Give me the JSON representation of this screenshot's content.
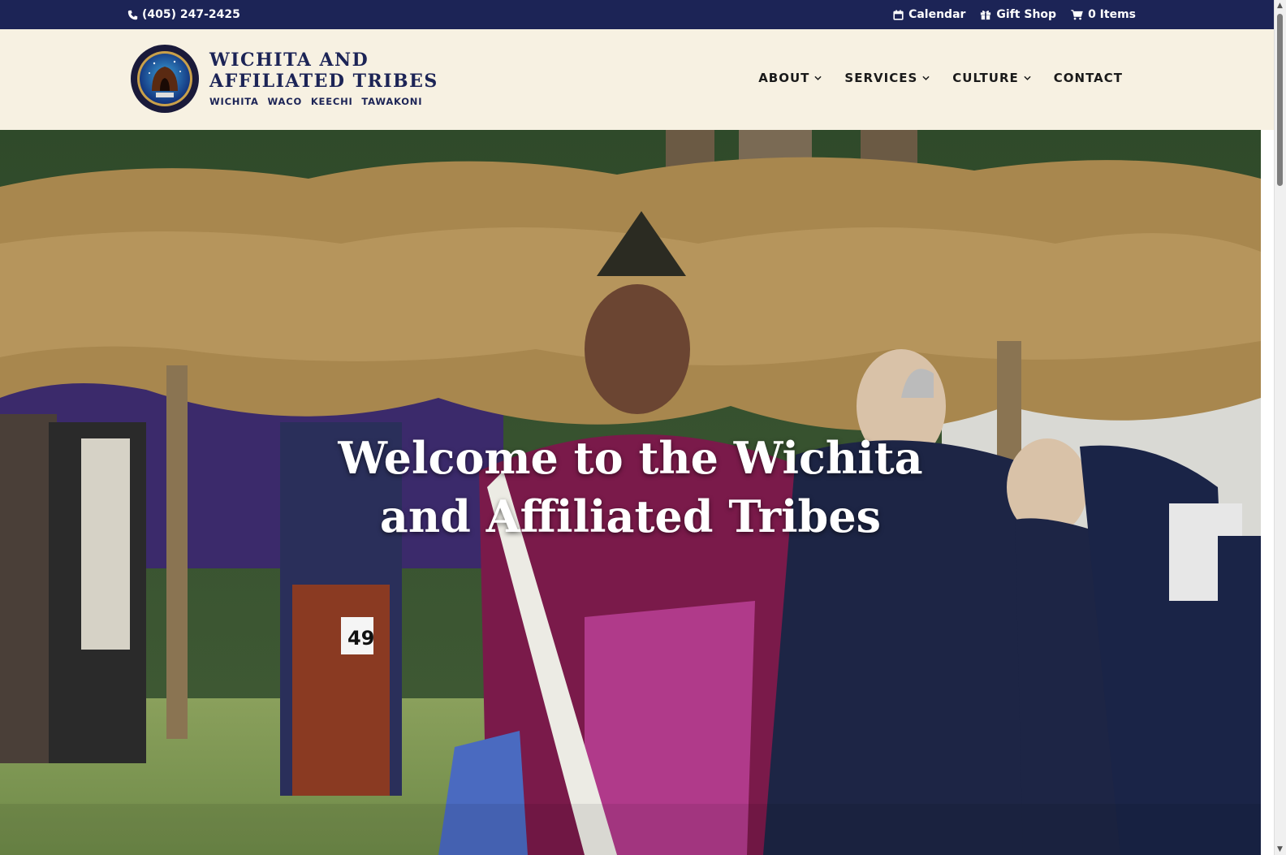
{
  "topbar": {
    "phone": "(405) 247-2425",
    "links": [
      {
        "label": "Calendar",
        "icon": "calendar-icon"
      },
      {
        "label": "Gift Shop",
        "icon": "gift-icon"
      },
      {
        "label": "0 Items",
        "icon": "cart-icon"
      }
    ]
  },
  "brand": {
    "seal_text": "SEAL OF THE WICHITA AND AFFILIATED TRIBES",
    "line1": "WICHITA AND",
    "line2": "AFFILIATED TRIBES",
    "line3": "WICHITA  WACO  KEECHI  TAWAKONI"
  },
  "nav": {
    "items": [
      {
        "label": "ABOUT",
        "has_dropdown": true
      },
      {
        "label": "SERVICES",
        "has_dropdown": true
      },
      {
        "label": "CULTURE",
        "has_dropdown": true
      },
      {
        "label": "CONTACT",
        "has_dropdown": false
      }
    ]
  },
  "hero": {
    "title_line1": "Welcome to the Wichita",
    "title_line2": "and Affiliated Tribes",
    "bib_number": "49"
  },
  "colors": {
    "topbar": "#1c2456",
    "header_bg": "#f7f1e2",
    "nav_text": "#1a1a1a",
    "brand_text": "#1c2456"
  }
}
